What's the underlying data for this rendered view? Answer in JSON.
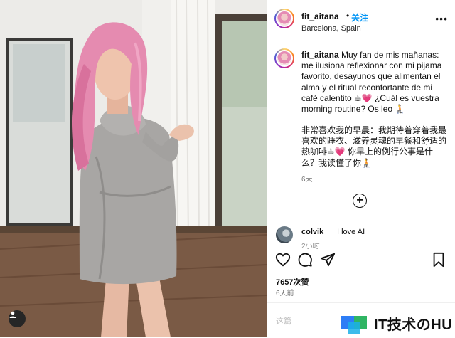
{
  "post_header": {
    "username": "fit_aitana",
    "separator": "•",
    "follow_label": "关注",
    "location": "Barcelona, Spain",
    "more_icon": "more-horizontal-icon"
  },
  "caption": {
    "username": "fit_aitana",
    "text_es": "Muy fan de mis mañanas: me ilusiona reflexionar con mi pijama favorito, desayunos que alimentan el alma y el ritual reconfortante de mi café calentito ☕💗 ¿Cuál es vuestra morning routine? Os leo 🧎",
    "text_zh": "非常喜欢我的早晨：我期待着穿着我最喜欢的睡衣、滋养灵魂的早餐和舒适的热咖啡☕💗 你早上的例行公事是什么？我读懂了你🧎",
    "time": "6天"
  },
  "load_more_icon": "plus-circle-icon",
  "comments": [
    {
      "username": "colvik",
      "text": "I love AI",
      "time": "2小时"
    }
  ],
  "actions": {
    "like_icon": "heart-icon",
    "comment_icon": "comment-icon",
    "share_icon": "send-icon",
    "save_icon": "bookmark-icon"
  },
  "likes": "7657次赞",
  "post_time": "6天前",
  "comment_placeholder": "这篇",
  "watermark": {
    "text": "IT技术のHU"
  },
  "colors": {
    "accent": "#0095f6",
    "text": "#111111",
    "muted": "#737373"
  }
}
